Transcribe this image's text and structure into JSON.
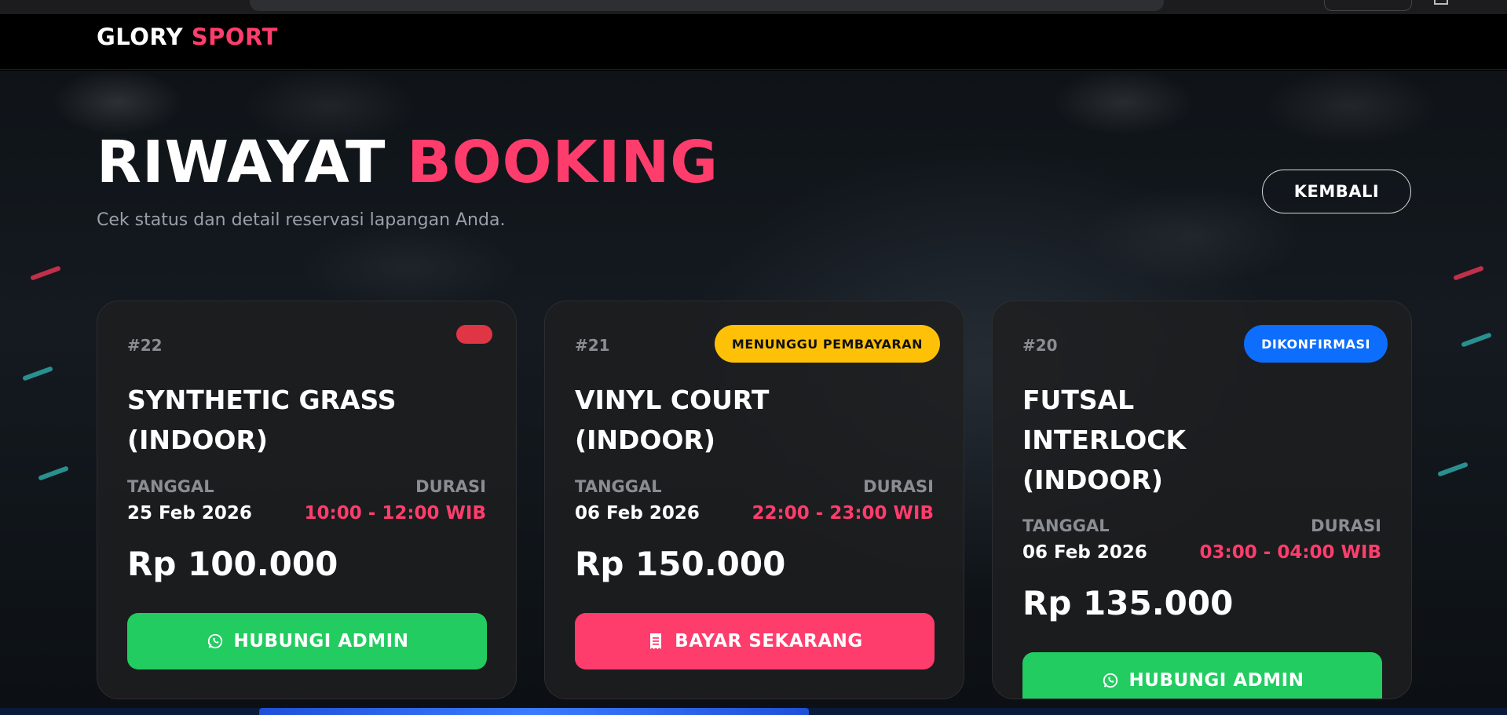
{
  "brand": {
    "name_part1": "GLORY",
    "name_part2": "SPORT"
  },
  "page": {
    "title_part1": "RIWAYAT",
    "title_part2": "BOOKING",
    "subtitle": "Cek status dan detail reservasi lapangan Anda.",
    "back_label": "KEMBALI"
  },
  "labels": {
    "date": "TANGGAL",
    "duration": "DURASI"
  },
  "bookings": [
    {
      "id": "#22",
      "status": "",
      "status_color": "#e03545",
      "title": "SYNTHETIC GRASS (INDOOR)",
      "date": "25 Feb 2026",
      "time": "10:00 - 12:00 WIB",
      "price": "Rp 100.000",
      "action_label": "HUBUNGI ADMIN",
      "action_icon": "whatsapp-icon"
    },
    {
      "id": "#21",
      "status": "MENUNGGU PEMBAYARAN",
      "status_color": "#ffc107",
      "title": "VINYL COURT (INDOOR)",
      "date": "06 Feb 2026",
      "time": "22:00 - 23:00 WIB",
      "price": "Rp 150.000",
      "action_label": "BAYAR SEKARANG",
      "action_icon": "receipt-icon"
    },
    {
      "id": "#20",
      "status": "DIKONFIRMASI",
      "status_color": "#0d6efd",
      "title": "FUTSAL INTERLOCK (INDOOR)",
      "date": "06 Feb 2026",
      "time": "03:00 - 04:00 WIB",
      "price": "Rp 135.000",
      "action_label": "HUBUNGI ADMIN",
      "action_icon": "whatsapp-icon"
    }
  ],
  "colors": {
    "accent": "#ff3d6d",
    "success": "#22cc60",
    "warning": "#ffc107",
    "info": "#0d6efd"
  }
}
